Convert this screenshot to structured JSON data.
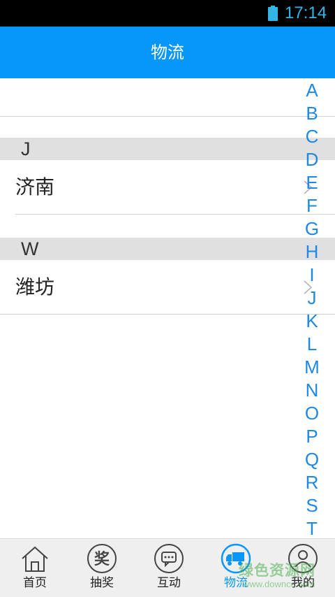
{
  "status_bar": {
    "time": "17:14",
    "battery_color": "#33b5e5"
  },
  "header": {
    "title": "物流",
    "background": "#0797fb"
  },
  "sections": [
    {
      "letter": "J",
      "cities": [
        {
          "name": "济南"
        }
      ]
    },
    {
      "letter": "W",
      "cities": [
        {
          "name": "潍坊"
        }
      ]
    }
  ],
  "index_bar": {
    "letters": [
      "A",
      "B",
      "C",
      "D",
      "E",
      "F",
      "G",
      "H",
      "I",
      "J",
      "K",
      "L",
      "M",
      "N",
      "O",
      "P",
      "Q",
      "R",
      "S",
      "T"
    ],
    "color": "#1e88e5"
  },
  "tab_bar": {
    "active_color": "#0797fb",
    "tabs": [
      {
        "label": "首页",
        "icon": "home-icon"
      },
      {
        "label": "抽奖",
        "icon": "lottery-icon",
        "glyph": "奖"
      },
      {
        "label": "互动",
        "icon": "chat-bubble-icon"
      },
      {
        "label": "物流",
        "icon": "truck-icon",
        "active": true
      },
      {
        "label": "我的",
        "icon": "user-icon"
      }
    ]
  },
  "watermark": {
    "main": "绿色资源网",
    "url": "www.downcc.com"
  }
}
